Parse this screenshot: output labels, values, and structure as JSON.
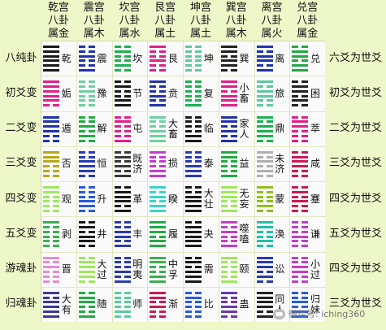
{
  "columns": [
    {
      "line1": "乾宫",
      "line2": "八卦",
      "line3": "属金"
    },
    {
      "line1": "震宫",
      "line2": "八卦",
      "line3": "属木"
    },
    {
      "line1": "坎宫",
      "line2": "八卦",
      "line3": "属水"
    },
    {
      "line1": "艮宫",
      "line2": "八卦",
      "line3": "属土"
    },
    {
      "line1": "坤宫",
      "line2": "八卦",
      "line3": "属土"
    },
    {
      "line1": "巽宫",
      "line2": "八卦",
      "line3": "属木"
    },
    {
      "line1": "离宫",
      "line2": "八卦",
      "line3": "属火"
    },
    {
      "line1": "兑宫",
      "line2": "八卦",
      "line3": "属金"
    }
  ],
  "row_labels": [
    "八纯卦",
    "初爻变",
    "二爻变",
    "三爻变",
    "四爻变",
    "五爻变",
    "游魂卦",
    "归魂卦"
  ],
  "right_labels": [
    "六爻为世爻",
    "初爻为世爻",
    "二爻为世爻",
    "三爻为世爻",
    "四爻为世爻",
    "五爻为世爻",
    "四爻为世爻",
    "三爻为世爻"
  ],
  "hexagrams": [
    [
      {
        "name": "乾",
        "lines": "111111",
        "color": "#1a1a1a"
      },
      {
        "name": "震",
        "lines": "100100",
        "color": "#2233aa"
      },
      {
        "name": "坎",
        "lines": "010010",
        "color": "#19b24f"
      },
      {
        "name": "艮",
        "lines": "001001",
        "color": "#e0208a"
      },
      {
        "name": "坤",
        "lines": "000000",
        "color": "#5ec9a0"
      },
      {
        "name": "巽",
        "lines": "011011",
        "color": "#222222"
      },
      {
        "name": "离",
        "lines": "101101",
        "color": "#1f35a8"
      },
      {
        "name": "兑",
        "lines": "110110",
        "color": "#22aa44"
      }
    ],
    [
      {
        "name": "姤",
        "lines": "011111",
        "color": "#e0208a"
      },
      {
        "name": "豫",
        "lines": "000100",
        "color": "#6fcf9f"
      },
      {
        "name": "节",
        "lines": "110010",
        "color": "#1a1a1a"
      },
      {
        "name": "贲",
        "lines": "101001",
        "color": "#2233aa"
      },
      {
        "name": "复",
        "lines": "100000",
        "color": "#19b24f"
      },
      {
        "name": "小畜",
        "lines": "111011",
        "color": "#e0208a"
      },
      {
        "name": "旅",
        "lines": "001101",
        "color": "#5ec9a0"
      },
      {
        "name": "困",
        "lines": "010110",
        "color": "#222222"
      }
    ],
    [
      {
        "name": "遁",
        "lines": "001111",
        "color": "#1f35a8"
      },
      {
        "name": "解",
        "lines": "010100",
        "color": "#22aa44"
      },
      {
        "name": "屯",
        "lines": "100010",
        "color": "#e0208a"
      },
      {
        "name": "大畜",
        "lines": "111001",
        "color": "#6fcf9f"
      },
      {
        "name": "临",
        "lines": "110000",
        "color": "#1a1a1a"
      },
      {
        "name": "家人",
        "lines": "101011",
        "color": "#2233aa"
      },
      {
        "name": "鼎",
        "lines": "011101",
        "color": "#19b24f"
      },
      {
        "name": "萃",
        "lines": "000110",
        "color": "#e0208a"
      }
    ],
    [
      {
        "name": "否",
        "lines": "000111",
        "color": "#b8a818"
      },
      {
        "name": "恒",
        "lines": "011100",
        "color": "#2a3bb0"
      },
      {
        "name": "既济",
        "lines": "101010",
        "color": "#3a3a3a"
      },
      {
        "name": "损",
        "lines": "110001",
        "color": "#c23ec8"
      },
      {
        "name": "泰",
        "lines": "111000",
        "color": "#2a3bb0"
      },
      {
        "name": "益",
        "lines": "100011",
        "color": "#22aa44"
      },
      {
        "name": "未济",
        "lines": "010101",
        "color": "#b0b0b0"
      },
      {
        "name": "咸",
        "lines": "001110",
        "color": "#cc1a55"
      }
    ],
    [
      {
        "name": "观",
        "lines": "000011",
        "color": "#9ee85a"
      },
      {
        "name": "升",
        "lines": "011000",
        "color": "#2a5bd8"
      },
      {
        "name": "革",
        "lines": "101110",
        "color": "#1a1a1a"
      },
      {
        "name": "睽",
        "lines": "110101",
        "color": "#3ad5c8"
      },
      {
        "name": "大壮",
        "lines": "111100",
        "color": "#1a1a1a"
      },
      {
        "name": "无妄",
        "lines": "100111",
        "color": "#9ee85a"
      },
      {
        "name": "蒙",
        "lines": "010001",
        "color": "#8fbf1a"
      },
      {
        "name": "蹇",
        "lines": "001010",
        "color": "#cc1a55"
      }
    ],
    [
      {
        "name": "剥",
        "lines": "000001",
        "color": "#3ab050"
      },
      {
        "name": "井",
        "lines": "011010",
        "color": "#1a1a1a"
      },
      {
        "name": "丰",
        "lines": "101100",
        "color": "#2a3bb0"
      },
      {
        "name": "履",
        "lines": "110111",
        "color": "#22aa44"
      },
      {
        "name": "夬",
        "lines": "111110",
        "color": "#1a1a1a"
      },
      {
        "name": "噬嗑",
        "lines": "100101",
        "color": "#c23ec8"
      },
      {
        "name": "涣",
        "lines": "010011",
        "color": "#22bfa8"
      },
      {
        "name": "谦",
        "lines": "001000",
        "color": "#c23ec8"
      }
    ],
    [
      {
        "name": "晋",
        "lines": "000101",
        "color": "#e88ad0"
      },
      {
        "name": "大过",
        "lines": "011110",
        "color": "#9ee85a"
      },
      {
        "name": "明夷",
        "lines": "101000",
        "color": "#2a3bb0"
      },
      {
        "name": "中孚",
        "lines": "110011",
        "color": "#3ab050"
      },
      {
        "name": "需",
        "lines": "111010",
        "color": "#1a1a1a"
      },
      {
        "name": "颐",
        "lines": "100001",
        "color": "#9ee85a"
      },
      {
        "name": "讼",
        "lines": "010111",
        "color": "#2a3bb0"
      },
      {
        "name": "小过",
        "lines": "001100",
        "color": "#c23ec8"
      }
    ],
    [
      {
        "name": "大有",
        "lines": "111101",
        "color": "#3a3a9a"
      },
      {
        "name": "随",
        "lines": "100110",
        "color": "#22aa44"
      },
      {
        "name": "师",
        "lines": "010000",
        "color": "#5ec9a0"
      },
      {
        "name": "渐",
        "lines": "001011",
        "color": "#cc1a55"
      },
      {
        "name": "比",
        "lines": "000010",
        "color": "#2a5bd8"
      },
      {
        "name": "蛊",
        "lines": "011001",
        "color": "#6a3ab0"
      },
      {
        "name": "同人",
        "lines": "101111",
        "color": "#222222"
      },
      {
        "name": "归妹",
        "lines": "110100",
        "color": "#2a5bd8"
      }
    ]
  ],
  "watermark": "微信号: iching360"
}
